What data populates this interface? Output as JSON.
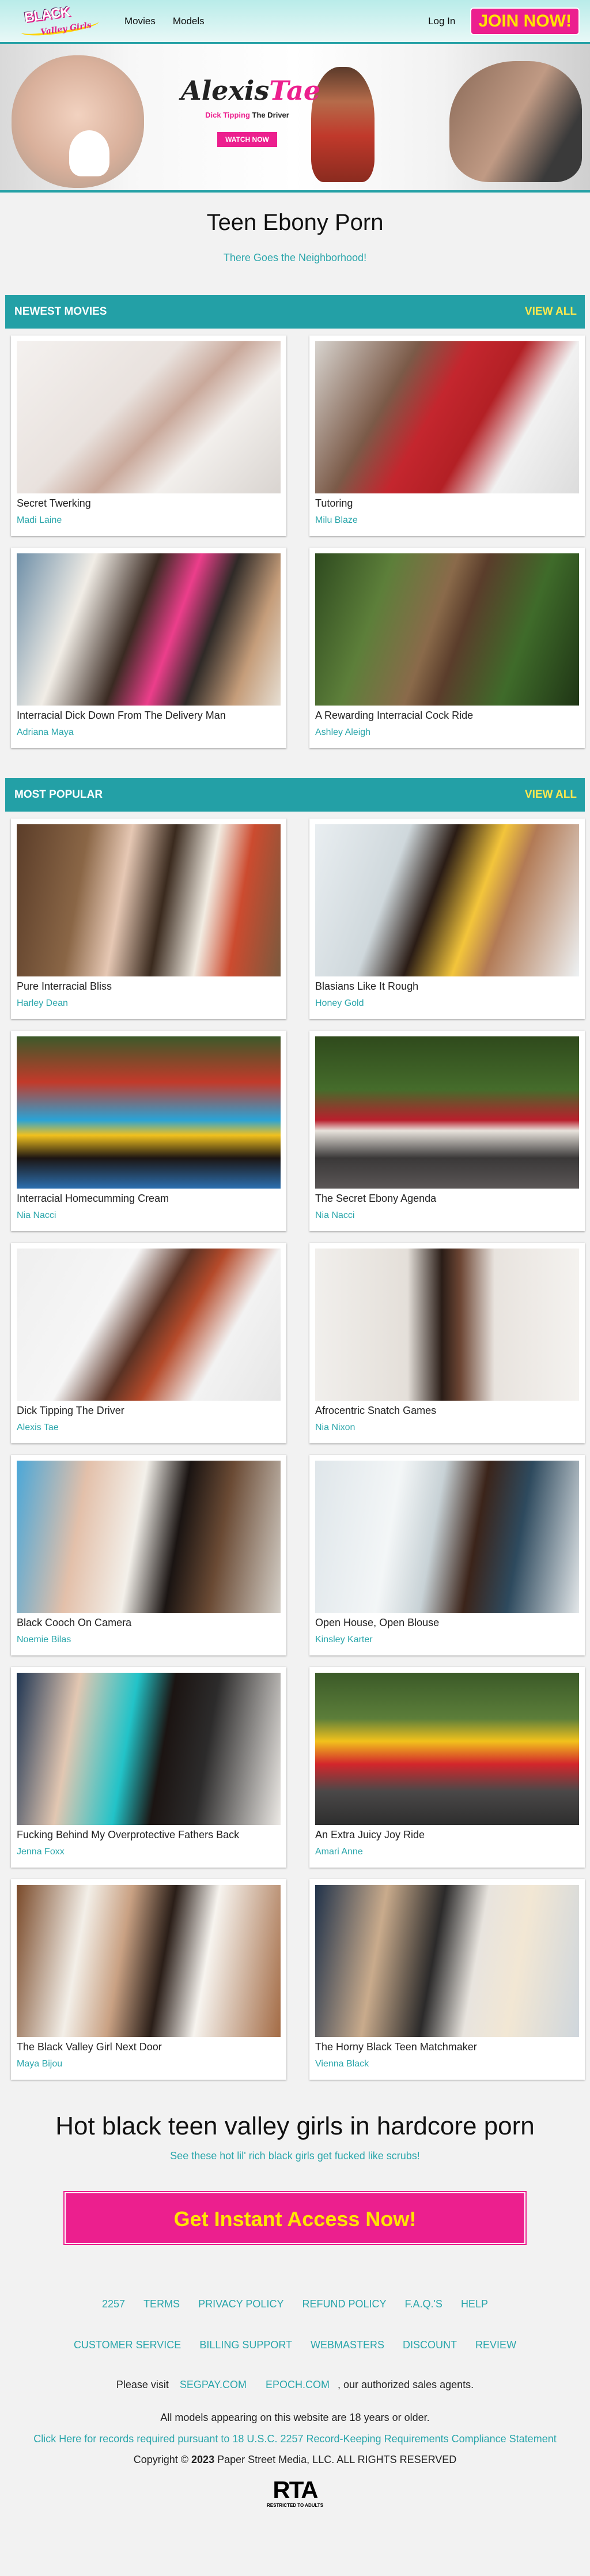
{
  "header": {
    "logo_line1": "BLACK",
    "logo_line2": "Valley Girls",
    "nav": [
      "Movies",
      "Models"
    ],
    "login": "Log In",
    "join": "JOIN NOW!"
  },
  "hero": {
    "name_first": "Alexis",
    "name_last": "Tae",
    "tag_pink": "Dick Tipping",
    "tag_dark": "The Driver",
    "watch": "WATCH NOW"
  },
  "page": {
    "title": "Teen Ebony Porn",
    "subtitle": "There Goes the Neighborhood!"
  },
  "newest": {
    "heading": "NEWEST MOVIES",
    "view_all": "VIEW ALL",
    "items": [
      {
        "title": "Secret Twerking",
        "model": "Madi Laine",
        "bg": "linear-gradient(135deg,#f4f1ef 0%,#e9e2de 40%,#c9a89a 55%,#f2efec 70%,#d9d4d0 100%)"
      },
      {
        "title": "Tutoring",
        "model": "Milu Blaze",
        "bg": "linear-gradient(120deg,#d8d4cf 0%,#7b5a48 30%,#c4262e 45%,#b32025 60%,#f1f1f1 75%,#dcdcdc 100%)"
      },
      {
        "title": "Interracial Dick Down From The Delivery Man",
        "model": "Adriana Maya",
        "bg": "linear-gradient(110deg,#6e8fa8 0%,#f1ede6 25%,#3a2a22 45%,#ec3e8b 58%,#2f2a27 70%,#c59d7a 85%,#e6ded2 100%)"
      },
      {
        "title": "A Rewarding Interracial Cock Ride",
        "model": "Ashley Aleigh",
        "bg": "linear-gradient(110deg,#2e4a1f 0%,#5d7f3a 25%,#8a6a4a 45%,#5a3d2b 55%,#3f6b2a 75%,#1f3515 100%)"
      }
    ]
  },
  "popular": {
    "heading": "MOST POPULAR",
    "view_all": "VIEW ALL",
    "items": [
      {
        "title": "Pure Interracial Bliss",
        "model": "Harley Dean",
        "bg": "linear-gradient(100deg,#5b3d29 0%,#8a6646 25%,#e6c8b4 40%,#3a2a1e 55%,#f2ece2 70%,#cc4b2f 82%,#7a5a3e 100%)"
      },
      {
        "title": "Blasians Like It Rough",
        "model": "Honey Gold",
        "bg": "linear-gradient(110deg,#e9eef1 0%,#cfd8dc 30%,#2a1c15 45%,#f3c53b 60%,#b27a55 70%,#eef2f4 100%)"
      },
      {
        "title": "Interracial Homecumming Cream",
        "model": "Nia Nacci",
        "bg": "linear-gradient(180deg,#3c5a2a 0%,#c23a2a 30%,#2aa3d6 55%,#f1c11e 65%,#1c1512 80%,#2b6fb0 100%)"
      },
      {
        "title": "The Secret Ebony Agenda",
        "model": "Nia Nacci",
        "bg": "linear-gradient(180deg,#2f4a1c 0%,#456c2b 35%,#b91f2c 55%,#e8e3dc 62%,#3a3838 80%,#5a5656 100%)"
      },
      {
        "title": "Dick Tipping The Driver",
        "model": "Alexis Tae",
        "bg": "linear-gradient(120deg,#efefef 0%,#f6f6f6 35%,#5a3224 50%,#b54a2a 60%,#f2f2f2 75%,#e6e6e6 100%)"
      },
      {
        "title": "Afrocentric Snatch Games",
        "model": "Nia Nixon",
        "bg": "linear-gradient(90deg,#f1efec 0%,#e4dfd9 35%,#2a1d17 48%,#6d4634 55%,#e8e3de 68%,#f4f2ef 100%)"
      },
      {
        "title": "Black Cooch On Camera",
        "model": "Noemie Bilas",
        "bg": "linear-gradient(100deg,#4aa7d8 0%,#e3c0aa 25%,#f3f0ea 45%,#1a1412 60%,#6a4a34 75%,#d4cfc7 100%)"
      },
      {
        "title": "Open House, Open Blouse",
        "model": "Kinsley Karter",
        "bg": "linear-gradient(100deg,#dfe6ea 0%,#f3f6f7 30%,#c8d2d6 45%,#3b241a 60%,#2e4a5e 75%,#e3e7e9 100%)"
      },
      {
        "title": "Fucking Behind My Overprotective Fathers Back",
        "model": "Jenna Foxx",
        "bg": "linear-gradient(100deg,#1f3552 0%,#e2c7b2 22%,#22c3c8 42%,#1b1412 55%,#2c2b2b 70%,#ece9e5 100%)"
      },
      {
        "title": "An Extra Juicy Joy Ride",
        "model": "Amari Anne",
        "bg": "linear-gradient(180deg,#3b5a28 0%,#5c7e3a 30%,#f2c21c 45%,#d3262b 60%,#4a4848 78%,#2e2e2e 100%)"
      },
      {
        "title": "The Black Valley Girl Next Door",
        "model": "Maya Bijou",
        "bg": "linear-gradient(100deg,#7a4a2a 0%,#f3efe8 25%,#c9a183 40%,#2a1e18 55%,#f7f4ef 70%,#a36b45 100%)"
      },
      {
        "title": "The Horny Black Teen Matchmaker",
        "model": "Vienna Black",
        "bg": "linear-gradient(100deg,#20324a 0%,#c9ab8c 25%,#2b2a2a 45%,#e8e4de 60%,#f2e7d4 75%,#cfd6dc 100%)"
      }
    ]
  },
  "cta": {
    "title": "Hot black teen valley girls in hardcore porn",
    "subtitle": "See these hot lil' rich black girls get fucked like scrubs!",
    "button": "Get Instant Access Now!"
  },
  "footer": {
    "row1": [
      "2257",
      "TERMS",
      "PRIVACY POLICY",
      "REFUND POLICY",
      "F.A.Q.'S",
      "HELP"
    ],
    "row2": [
      "CUSTOMER SERVICE",
      "BILLING SUPPORT",
      "WEBMASTERS",
      "DISCOUNT",
      "REVIEW"
    ],
    "visit_prefix": "Please visit",
    "visit_links": [
      "SEGPAY.COM",
      "EPOCH.COM"
    ],
    "visit_suffix": ", our authorized sales agents.",
    "age_notice": "All models appearing on this website are 18 years or older.",
    "records_link": "Click Here for records required pursuant to 18 U.S.C. 2257 Record-Keeping Requirements Compliance Statement",
    "copyright_prefix": "Copyright ©",
    "copyright_year": "2023",
    "copyright_suffix": "Paper Street Media, LLC. ALL RIGHTS RESERVED",
    "rta_logo": "RTA",
    "rta_sub": "RESTRICTED TO ADULTS"
  }
}
